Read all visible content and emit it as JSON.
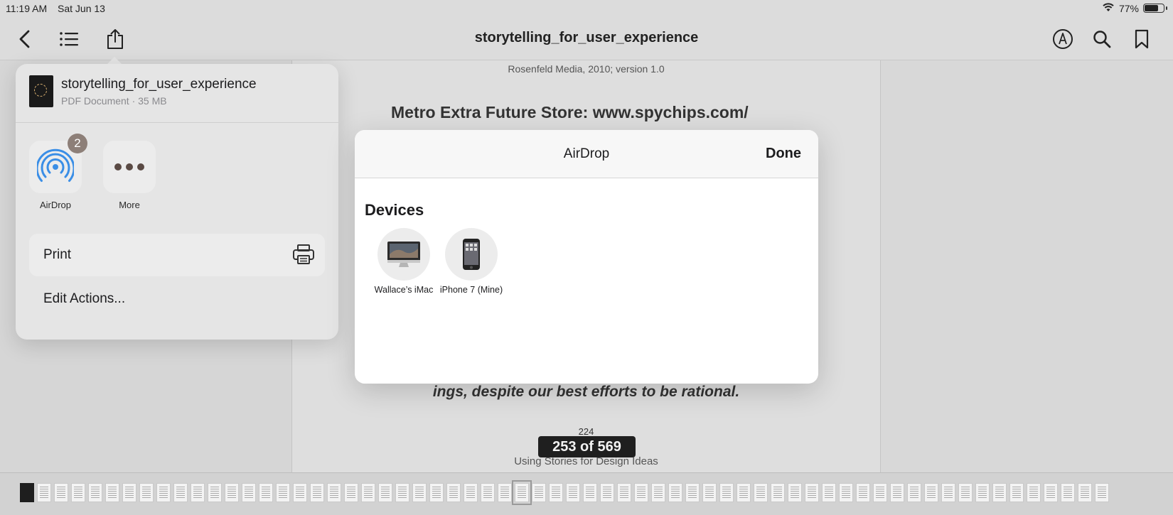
{
  "status_bar": {
    "time": "11:19 AM",
    "date": "Sat Jun 13",
    "battery_percent": "77%",
    "battery_level": 0.77,
    "icons": [
      "wifi-icon",
      "battery-icon"
    ]
  },
  "toolbar": {
    "title": "storytelling_for_user_experience",
    "left_icons": [
      "back-chevron-icon",
      "list-icon",
      "share-icon"
    ],
    "right_icons": [
      "markup-pen-icon",
      "search-icon",
      "bookmark-icon"
    ]
  },
  "document": {
    "publisher_line": "Rosenfeld Media, 2010; version 1.0",
    "body_line": "Metro Extra Future Store: www.spychips.com/",
    "quote_line": "ings, despite our best efforts to be rational.",
    "page_number": "224",
    "chapter_title": "Using Stories for Design Ideas",
    "page_indicator": "253 of 569"
  },
  "share_sheet": {
    "file_name": "storytelling_for_user_experience",
    "file_meta": "PDF Document · 35 MB",
    "apps": [
      {
        "label": "AirDrop",
        "icon": "airdrop-icon",
        "badge": "2"
      },
      {
        "label": "More",
        "icon": "more-dots-icon"
      }
    ],
    "print_label": "Print",
    "edit_actions_label": "Edit Actions..."
  },
  "airdrop": {
    "title": "AirDrop",
    "done_label": "Done",
    "section_title": "Devices",
    "devices": [
      {
        "label": "Wallace’s iMac",
        "icon": "imac-icon"
      },
      {
        "label": "iPhone 7 (Mine)",
        "icon": "iphone-icon"
      }
    ]
  },
  "colors": {
    "accent_airdrop": "#3a8ee6",
    "page_indicator_bg": "#1f1f1f",
    "badge": "#8d7f78"
  }
}
